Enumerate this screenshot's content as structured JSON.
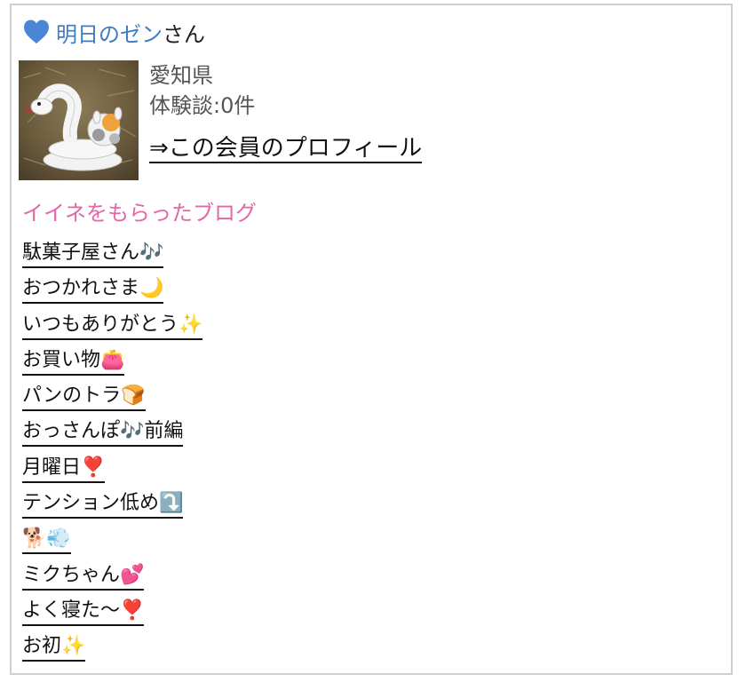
{
  "member": {
    "name": "明日のゼン",
    "honorific": "さん",
    "prefecture": "愛知県",
    "experience_count": "体験談:0件",
    "profile_link": "⇒この会員のプロフィール",
    "avatar_alt": "ヘビのぬいぐるみの写真"
  },
  "liked_blogs": {
    "title": "イイネをもらったブログ",
    "items": [
      "駄菓子屋さん🎶",
      "おつかれさま🌙",
      "いつもありがとう✨",
      "お買い物👛",
      "パンのトラ🍞",
      "おっさんぽ🎶前編",
      "月曜日❣️",
      "テンション低め⤵️",
      "🐕💨",
      "ミクちゃん💕",
      "よく寝た〜❣️",
      "お初✨"
    ]
  },
  "colors": {
    "name_blue": "#3f7cc4",
    "heart_blue": "#4a86d6",
    "section_pink": "#e466a7",
    "border_gray": "#cfcfcf"
  }
}
